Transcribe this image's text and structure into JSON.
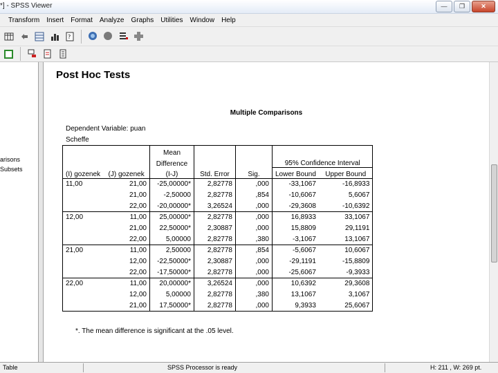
{
  "window": {
    "title": "*] - SPSS Viewer"
  },
  "menu": [
    "Transform",
    "Insert",
    "Format",
    "Analyze",
    "Graphs",
    "Utilities",
    "Window",
    "Help"
  ],
  "toolbar1_icons": [
    "table-icon",
    "back-arrow-icon",
    "grid-icon",
    "chart-icon",
    "zoom-icon",
    "stats-icon",
    "bars-icon",
    "red-dot-icon",
    "gray-cross-icon",
    "eye-icon",
    "vars-icon",
    "plus-icon"
  ],
  "toolbar2_icons": [
    "green-box-icon",
    "red-arrow-icon",
    "red-script-icon",
    "doc-icon"
  ],
  "outline": {
    "item1": "arisons",
    "item2": "Subsets"
  },
  "output": {
    "heading": "Post Hoc Tests",
    "caption": "Multiple Comparisons",
    "dependent_variable": "Dependent Variable: puan",
    "method": "Scheffe",
    "footnote": "*. The mean difference is significant at the .05 level."
  },
  "table": {
    "headers": {
      "i": "(I) gozenek",
      "j": "(J) gozenek",
      "mean_diff_line1": "Mean",
      "mean_diff_line2": "Difference",
      "mean_diff_line3": "(I-J)",
      "std_error": "Std. Error",
      "sig": "Sig.",
      "ci": "95% Confidence Interval",
      "lower": "Lower Bound",
      "upper": "Upper Bound"
    },
    "groups": [
      {
        "i": "11,00",
        "rows": [
          {
            "j": "21,00",
            "md": "-25,00000*",
            "se": "2,82778",
            "sig": ",000",
            "lb": "-33,1067",
            "ub": "-16,8933"
          },
          {
            "j": "21,00",
            "md": "-2,50000",
            "se": "2,82778",
            "sig": ",854",
            "lb": "-10,6067",
            "ub": "5,6067"
          },
          {
            "j": "22,00",
            "md": "-20,00000*",
            "se": "3,26524",
            "sig": ",000",
            "lb": "-29,3608",
            "ub": "-10,6392"
          }
        ]
      },
      {
        "i": "12,00",
        "rows": [
          {
            "j": "11,00",
            "md": "25,00000*",
            "se": "2,82778",
            "sig": ",000",
            "lb": "16,8933",
            "ub": "33,1067"
          },
          {
            "j": "21,00",
            "md": "22,50000*",
            "se": "2,30887",
            "sig": ",000",
            "lb": "15,8809",
            "ub": "29,1191"
          },
          {
            "j": "22,00",
            "md": "5,00000",
            "se": "2,82778",
            "sig": ",380",
            "lb": "-3,1067",
            "ub": "13,1067"
          }
        ]
      },
      {
        "i": "21,00",
        "rows": [
          {
            "j": "11,00",
            "md": "2,50000",
            "se": "2,82778",
            "sig": ",854",
            "lb": "-5,6067",
            "ub": "10,6067"
          },
          {
            "j": "12,00",
            "md": "-22,50000*",
            "se": "2,30887",
            "sig": ",000",
            "lb": "-29,1191",
            "ub": "-15,8809"
          },
          {
            "j": "22,00",
            "md": "-17,50000*",
            "se": "2,82778",
            "sig": ",000",
            "lb": "-25,6067",
            "ub": "-9,3933"
          }
        ]
      },
      {
        "i": "22,00",
        "rows": [
          {
            "j": "11,00",
            "md": "20,00000*",
            "se": "3,26524",
            "sig": ",000",
            "lb": "10,6392",
            "ub": "29,3608"
          },
          {
            "j": "12,00",
            "md": "5,00000",
            "se": "2,82778",
            "sig": ",380",
            "lb": "13,1067",
            "ub": "3,1067"
          },
          {
            "j": "21,00",
            "md": "17,50000*",
            "se": "2,82778",
            "sig": ",000",
            "lb": "9,3933",
            "ub": "25,6067"
          }
        ]
      }
    ]
  },
  "status": {
    "left": "Table",
    "center": "SPSS Processor is ready",
    "right": "H: 211 , W: 269  pt."
  }
}
